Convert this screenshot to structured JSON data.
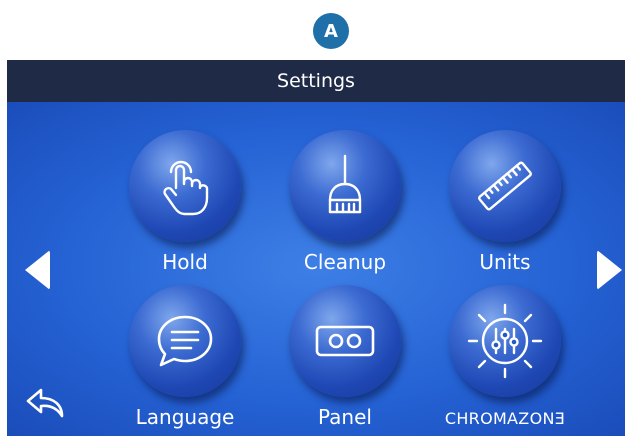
{
  "badge": {
    "letter": "A"
  },
  "header": {
    "title": "Settings"
  },
  "tiles": [
    {
      "label": "Hold",
      "icon": "touch-hand-icon"
    },
    {
      "label": "Cleanup",
      "icon": "broom-icon"
    },
    {
      "label": "Units",
      "icon": "ruler-icon"
    },
    {
      "label": "Language",
      "icon": "speech-bubble-icon"
    },
    {
      "label": "Panel",
      "icon": "panel-icon"
    },
    {
      "label": "CHROMAZONƎ",
      "icon": "chromazone-icon"
    }
  ],
  "nav": {
    "prev": "left-arrow-icon",
    "next": "right-arrow-icon",
    "back": "back-arrow-icon"
  },
  "colors": {
    "header_bg": "#1f2b46",
    "screen_bg": "#2562d4",
    "badge_bg": "#1f6fa8",
    "text": "#ffffff"
  }
}
